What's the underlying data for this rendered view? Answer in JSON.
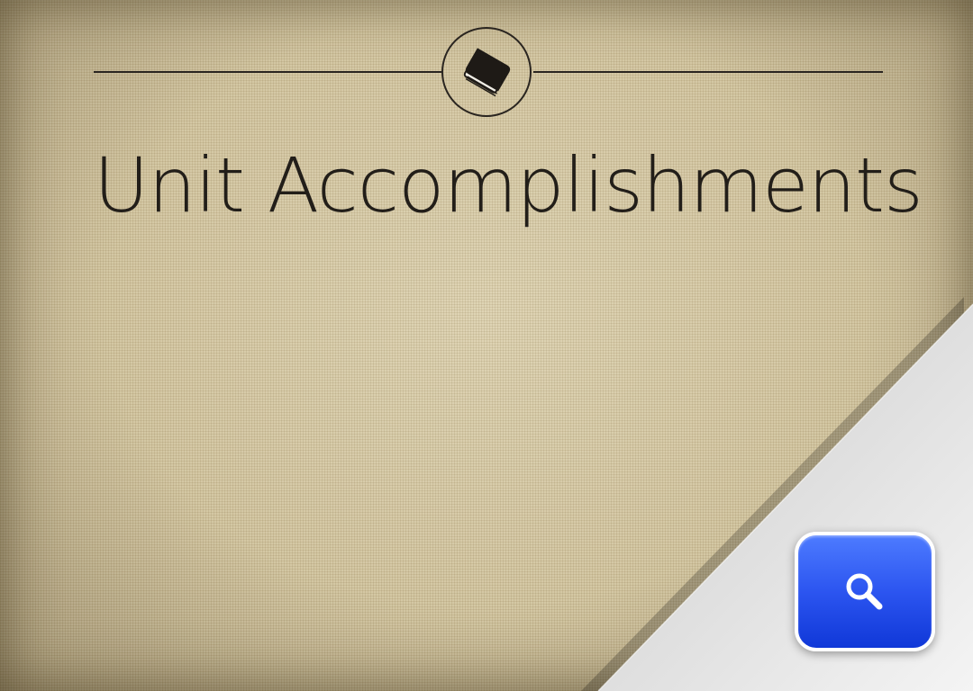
{
  "header": {
    "emblem_icon": "book-icon",
    "title": "Unit Accomplishments"
  },
  "actions": {
    "search_icon": "magnifier-icon"
  },
  "colors": {
    "background": "#cfc19b",
    "ink": "#221e19",
    "button_blue": "#2c55f0",
    "curl_light": "#f2f2f2"
  }
}
